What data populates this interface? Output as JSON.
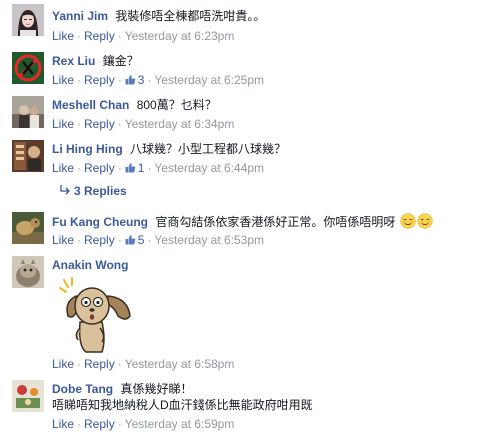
{
  "comments": [
    {
      "name": "Yanni Jim",
      "text": "我裝修唔全棟都唔洗咁貴。。",
      "like": "Like",
      "reply": "Reply",
      "time": "Yesterday at 6:23pm"
    },
    {
      "name": "Rex Liu",
      "text": "鑲金？",
      "like": "Like",
      "reply": "Reply",
      "likes": "3",
      "time": "Yesterday at 6:25pm"
    },
    {
      "name": "Meshell Chan",
      "text": "800萬？乜料？",
      "like": "Like",
      "reply": "Reply",
      "time": "Yesterday at 6:34pm"
    },
    {
      "name": "Li Hing Hing",
      "text": "八球幾？小型工程都八球幾？",
      "like": "Like",
      "reply": "Reply",
      "likes": "1",
      "time": "Yesterday at 6:44pm",
      "replies_label": "3 Replies"
    },
    {
      "name": "Fu Kang Cheung",
      "text": "官商勾結係依家香港係好正常。你唔係唔明呀",
      "like": "Like",
      "reply": "Reply",
      "likes": "5",
      "time": "Yesterday at 6:53pm"
    },
    {
      "name": "Anakin Wong",
      "text": "",
      "like": "Like",
      "reply": "Reply",
      "time": "Yesterday at 6:58pm"
    },
    {
      "name": "Dobe Tang",
      "text": "真係幾好睇！",
      "text2": "唔睇唔知我地納稅人D血汗錢係比無能政府咁用既",
      "like": "Like",
      "reply": "Reply",
      "time": "Yesterday at 6:59pm"
    }
  ],
  "icons": {
    "thumb": "thumbs-up-icon",
    "reply_arrow": "reply-arrow-icon",
    "emoji": "relieved-face-emoji",
    "sticker": "dog-sticker"
  },
  "colors": {
    "link": "#3b5998",
    "meta": "#9197a3",
    "text": "#141823"
  }
}
